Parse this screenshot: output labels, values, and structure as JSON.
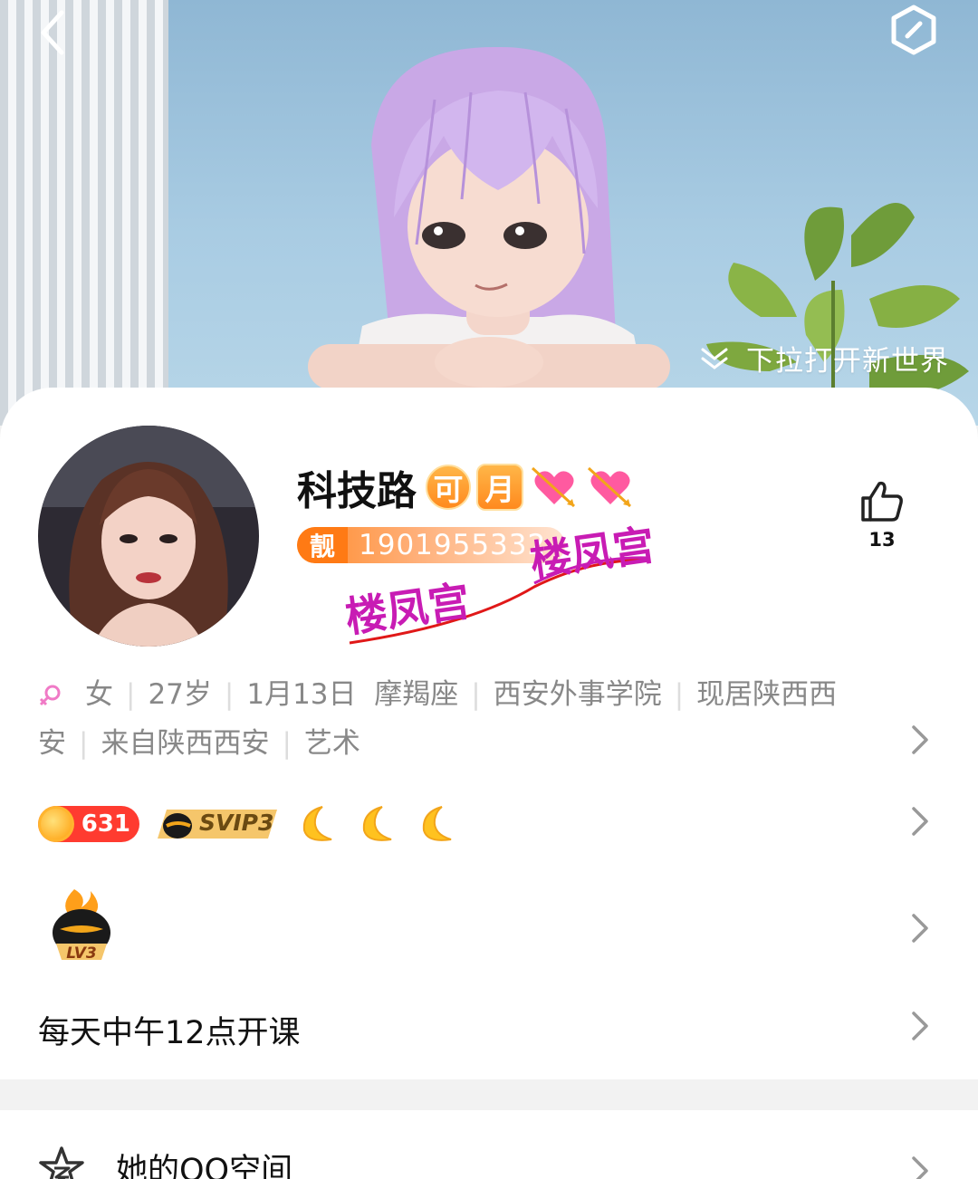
{
  "hero": {
    "pull_hint": "下拉打开新世界"
  },
  "profile": {
    "name": "科技路",
    "badge_ke": "可",
    "badge_yue": "月",
    "uid_prefix": "靓",
    "uid": "1901955332",
    "watermark": "楼凤宫",
    "likes": "13"
  },
  "info": {
    "gender": "女",
    "age": "27岁",
    "birthday": "1月13日",
    "zodiac": "摩羯座",
    "school": "西安外事学院",
    "location_line1": "现居陕西西",
    "location_line2": "安",
    "hometown": "来自陕西西安",
    "occupation": "艺术"
  },
  "badges": {
    "coin_count": "631",
    "svip": "SVIP3"
  },
  "level": {
    "label": "LV3"
  },
  "signature": "每天中午12点开课",
  "space": {
    "label": "她的QQ空间"
  },
  "colors": {
    "accent_orange": "#ff8a1e",
    "watermark_magenta": "#c81cb4",
    "gender_pink": "#f07ac6"
  }
}
